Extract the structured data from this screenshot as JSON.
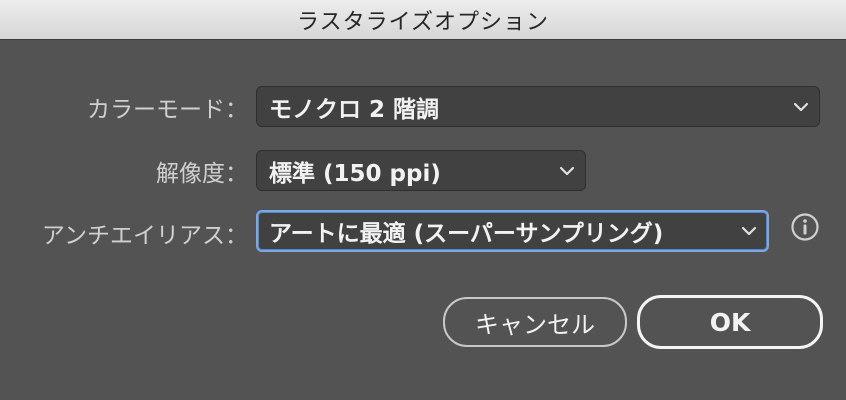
{
  "window": {
    "title": "ラスタライズオプション"
  },
  "options": {
    "color_model": {
      "label": "カラーモード：",
      "value": "モノクロ 2 階調"
    },
    "resolution": {
      "label": "解像度：",
      "value": "標準 (150 ppi)"
    },
    "antialias": {
      "label": "アンチエイリアス：",
      "value": "アートに最適 (スーパーサンプリング)"
    }
  },
  "icons": {
    "chevron": "chevron-down-icon",
    "info": "info-icon"
  },
  "buttons": {
    "cancel_label": "キャンセル",
    "ok_label": "OK"
  },
  "colors": {
    "background": "#535353",
    "field": "#414141",
    "focus_ring": "#7aa7e6"
  }
}
